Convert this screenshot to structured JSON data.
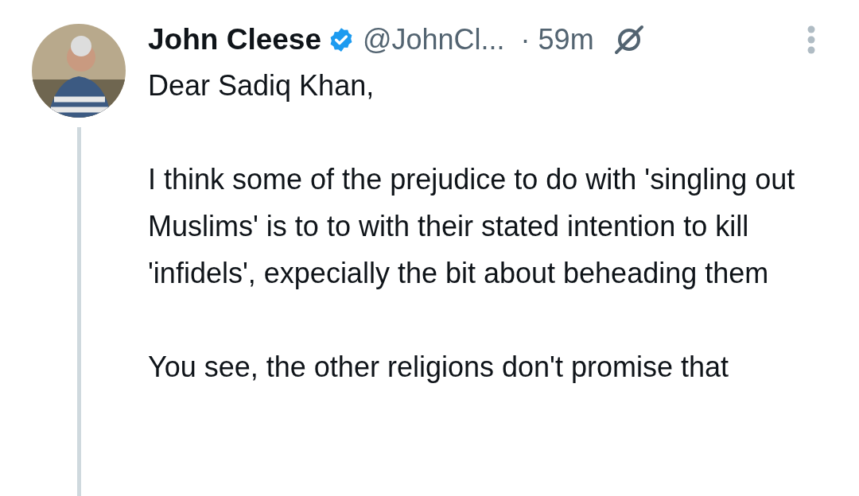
{
  "post": {
    "author": {
      "name": "John Cleese",
      "verified": true,
      "handle": "@JohnCl...",
      "time": "· 59m"
    },
    "paragraphs": [
      "Dear Sadiq Khan,",
      "I think some of the prejudice to do with 'singling out Muslims' is to to with their stated intention to kill 'infidels', expecially the bit about beheading them",
      "You see, the other religions don't promise that"
    ]
  }
}
